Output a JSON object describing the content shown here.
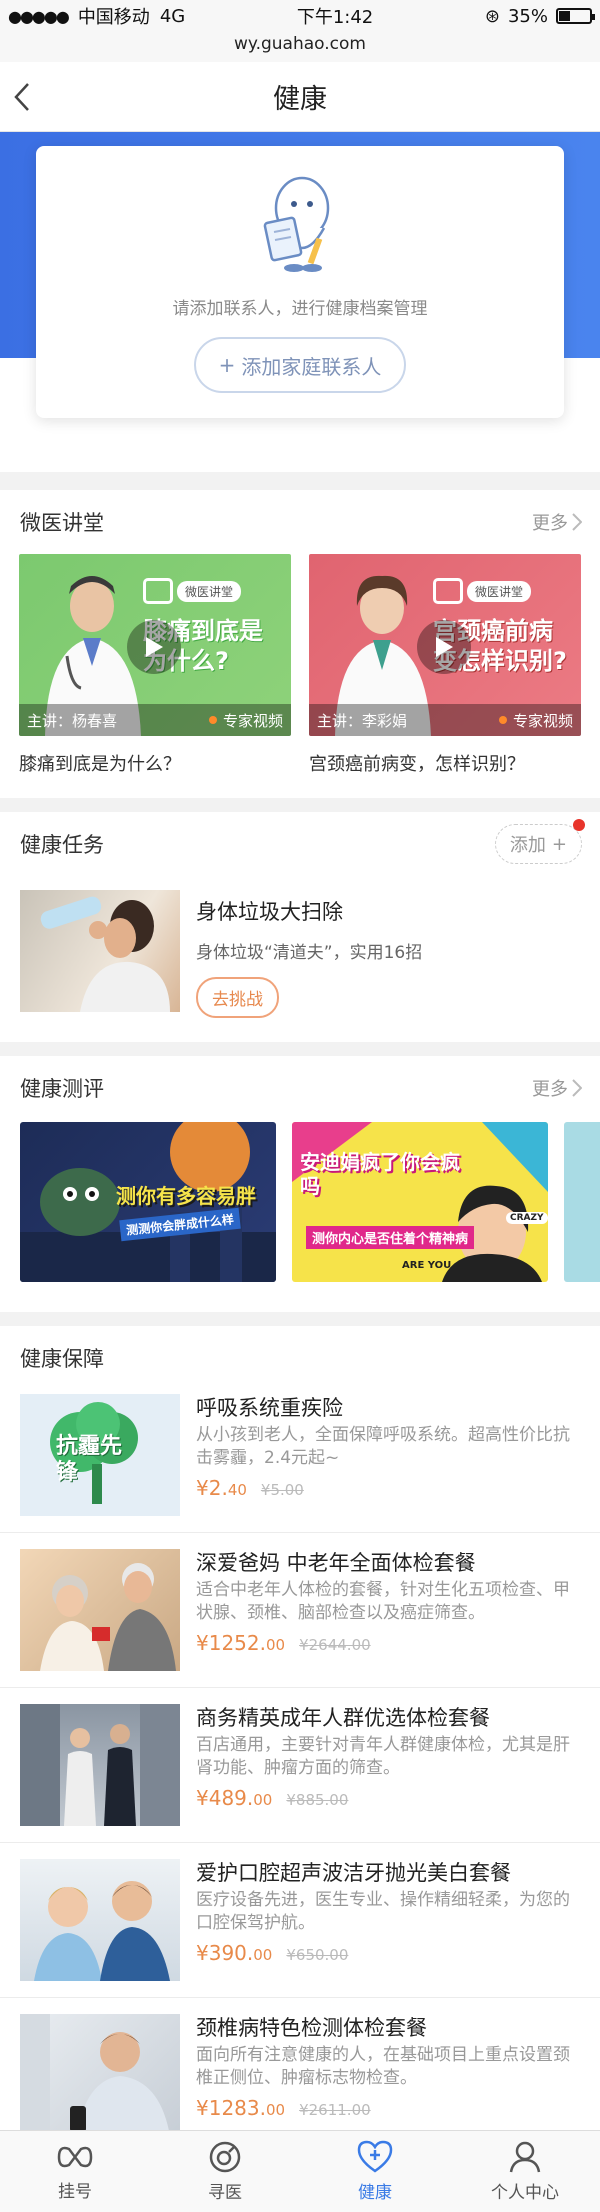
{
  "status_bar": {
    "carrier": "中国移动",
    "network": "4G",
    "time": "下午1:42",
    "battery": "35%"
  },
  "url": "wy.guahao.com",
  "nav": {
    "title": "健康"
  },
  "hero": {
    "hint": "请添加联系人，进行健康档案管理",
    "add_button": "添加家庭联系人"
  },
  "lectures": {
    "title": "微医讲堂",
    "more": "更多",
    "items": [
      {
        "headline": "膝痛到底是为什么?",
        "tv_label": "微医讲堂",
        "speaker": "主讲：杨春喜",
        "tag": "专家视频",
        "title": "膝痛到底是为什么？"
      },
      {
        "headline": "宫颈癌前病变怎样识别?",
        "tv_label": "微医讲堂",
        "speaker": "主讲：李彩娟",
        "tag": "专家视频",
        "title": "宫颈癌前病变，怎样识别？"
      }
    ]
  },
  "tasks": {
    "title": "健康任务",
    "add": "添加",
    "items": [
      {
        "title": "身体垃圾大扫除",
        "subtitle": "身体垃圾“清道夫”，实用16招",
        "action": "去挑战"
      }
    ]
  },
  "assessments": {
    "title": "健康测评",
    "more": "更多",
    "items": [
      {
        "text": "测你有多容易胖",
        "sub": "测测你会胖成什么样"
      },
      {
        "text": "安迪娟疯了你会疯吗",
        "sub": "测你内心是否住着个精神病",
        "badge": "ARE YOU",
        "crazy": "CRAZY"
      }
    ]
  },
  "insurance": {
    "title": "健康保障",
    "items": [
      {
        "title": "呼吸系统重疾险",
        "desc": "从小孩到老人，全面保障呼吸系统。超高性价比抗击雾霾，2.4元起~",
        "price_main": "¥2.",
        "price_dec": "40",
        "price_old": "¥5.00",
        "badge": "抗霾先锋"
      },
      {
        "title": "深爱爸妈 中老年全面体检套餐",
        "desc": "适合中老年人体检的套餐，针对生化五项检查、甲状腺、颈椎、脑部检查以及癌症筛查。",
        "price_main": "¥1252.",
        "price_dec": "00",
        "price_old": "¥2644.00"
      },
      {
        "title": "商务精英成年人群优选体检套餐",
        "desc": "百店通用，主要针对青年人群健康体检，尤其是肝肾功能、肿瘤方面的筛查。",
        "price_main": "¥489.",
        "price_dec": "00",
        "price_old": "¥885.00"
      },
      {
        "title": "爱护口腔超声波洁牙抛光美白套餐",
        "desc": "医疗设备先进，医生专业、操作精细轻柔，为您的口腔保驾护航。",
        "price_main": "¥390.",
        "price_dec": "00",
        "price_old": "¥650.00"
      },
      {
        "title": "颈椎病特色检测体检套餐",
        "desc": "面向所有注意健康的人，在基础项目上重点设置颈椎正侧位、肿瘤标志物检查。",
        "price_main": "¥1283.",
        "price_dec": "00",
        "price_old": "¥2611.00"
      }
    ]
  },
  "tabbar": {
    "items": [
      {
        "label": "挂号"
      },
      {
        "label": "寻医"
      },
      {
        "label": "健康"
      },
      {
        "label": "个人中心"
      }
    ]
  },
  "colors": {
    "accent": "#3a7be6",
    "price": "#e88a4a",
    "hero_blue": "#3b6fe3"
  }
}
